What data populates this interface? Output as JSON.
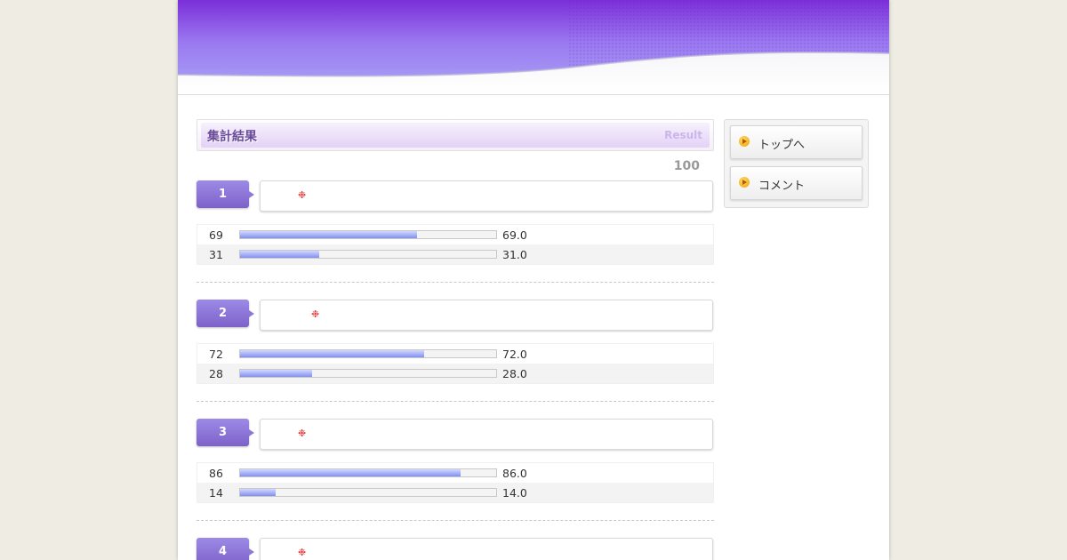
{
  "main": {
    "title": "集計結果",
    "title_sub": "Result",
    "total": "100"
  },
  "questions": [
    {
      "number": "1",
      "mark": "❉",
      "answers": [
        {
          "count": "69",
          "percent": "69.0",
          "ratio": 0.69
        },
        {
          "count": "31",
          "percent": "31.0",
          "ratio": 0.31
        }
      ]
    },
    {
      "number": "2",
      "mark": "❉",
      "answers": [
        {
          "count": "72",
          "percent": "72.0",
          "ratio": 0.72
        },
        {
          "count": "28",
          "percent": "28.0",
          "ratio": 0.28
        }
      ]
    },
    {
      "number": "3",
      "mark": "❉",
      "answers": [
        {
          "count": "86",
          "percent": "86.0",
          "ratio": 0.86
        },
        {
          "count": "14",
          "percent": "14.0",
          "ratio": 0.14
        }
      ]
    },
    {
      "number": "4",
      "mark": "❉",
      "answers": []
    }
  ],
  "sidebar": {
    "items": [
      {
        "label": "トップへ",
        "icon": "arrow-bullet-icon"
      },
      {
        "label": "コメント",
        "icon": "arrow-bullet-icon"
      }
    ]
  },
  "colors": {
    "accent": "#7d62c9",
    "bar_fill": "#8090ee",
    "mark": "#e03030",
    "page_bg": "#efede3"
  }
}
